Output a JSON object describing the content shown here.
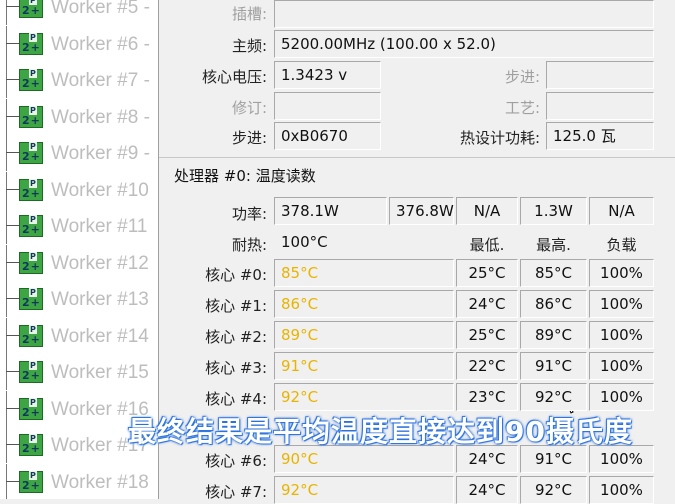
{
  "workers": [
    {
      "label": "Worker #5 - "
    },
    {
      "label": "Worker #6 - "
    },
    {
      "label": "Worker #7 - "
    },
    {
      "label": "Worker #8 - "
    },
    {
      "label": "Worker #9 - "
    },
    {
      "label": "Worker #10"
    },
    {
      "label": "Worker #11"
    },
    {
      "label": "Worker #12"
    },
    {
      "label": "Worker #13"
    },
    {
      "label": "Worker #14"
    },
    {
      "label": "Worker #15"
    },
    {
      "label": "Worker #16"
    },
    {
      "label": "Worker #17"
    },
    {
      "label": "Worker #18"
    }
  ],
  "icon_text": {
    "top": "P",
    "bottom": "2+"
  },
  "cpu": {
    "slot_label": "插槽:",
    "slot_value": "",
    "freq_label": "主频:",
    "freq_value": "5200.00MHz (100.00 x 52.0)",
    "voltage_label": "核心电压:",
    "voltage_value": "1.3423 v",
    "stepping_label_dim": "步进:",
    "stepping_value_dim": "",
    "revision_label": "修订:",
    "revision_value": "",
    "process_label": "工艺:",
    "process_value": "",
    "stepping_label": "步进:",
    "stepping_value": "0xB0670",
    "tdp_label": "热设计功耗:",
    "tdp_value": "125.0 瓦"
  },
  "thermal": {
    "section_title": "处理器 #0: 温度读数",
    "power_label": "功率:",
    "power_values": [
      "378.1W",
      "376.8W",
      "N/A",
      "1.3W",
      "N/A"
    ],
    "tjmax_label": "耐热:",
    "tjmax_value": "100°C",
    "col_min": "最低.",
    "col_max": "最高.",
    "col_load": "负载",
    "cores": [
      {
        "label": "核心 #0:",
        "temp": "85°C",
        "min": "25°C",
        "max": "85°C",
        "load": "100%"
      },
      {
        "label": "核心 #1:",
        "temp": "86°C",
        "min": "24°C",
        "max": "86°C",
        "load": "100%"
      },
      {
        "label": "核心 #2:",
        "temp": "89°C",
        "min": "25°C",
        "max": "89°C",
        "load": "100%"
      },
      {
        "label": "核心 #3:",
        "temp": "91°C",
        "min": "22°C",
        "max": "91°C",
        "load": "100%"
      },
      {
        "label": "核心 #4:",
        "temp": "92°C",
        "min": "23°C",
        "max": "92°C",
        "load": "100%"
      },
      {
        "label": "",
        "temp": "",
        "min": "",
        "max": "",
        "load": ""
      },
      {
        "label": "核心 #6:",
        "temp": "90°C",
        "min": "24°C",
        "max": "91°C",
        "load": "100%"
      },
      {
        "label": "核心 #7:",
        "temp": "92°C",
        "min": "24°C",
        "max": "92°C",
        "load": "100%"
      }
    ]
  },
  "caption": "最终结果是平均温度直接达到90摄氏度",
  "colors": {
    "hot_temp": "#e8b400",
    "caption_outline": "#2a6fd6",
    "icon_green": "#3da544"
  }
}
